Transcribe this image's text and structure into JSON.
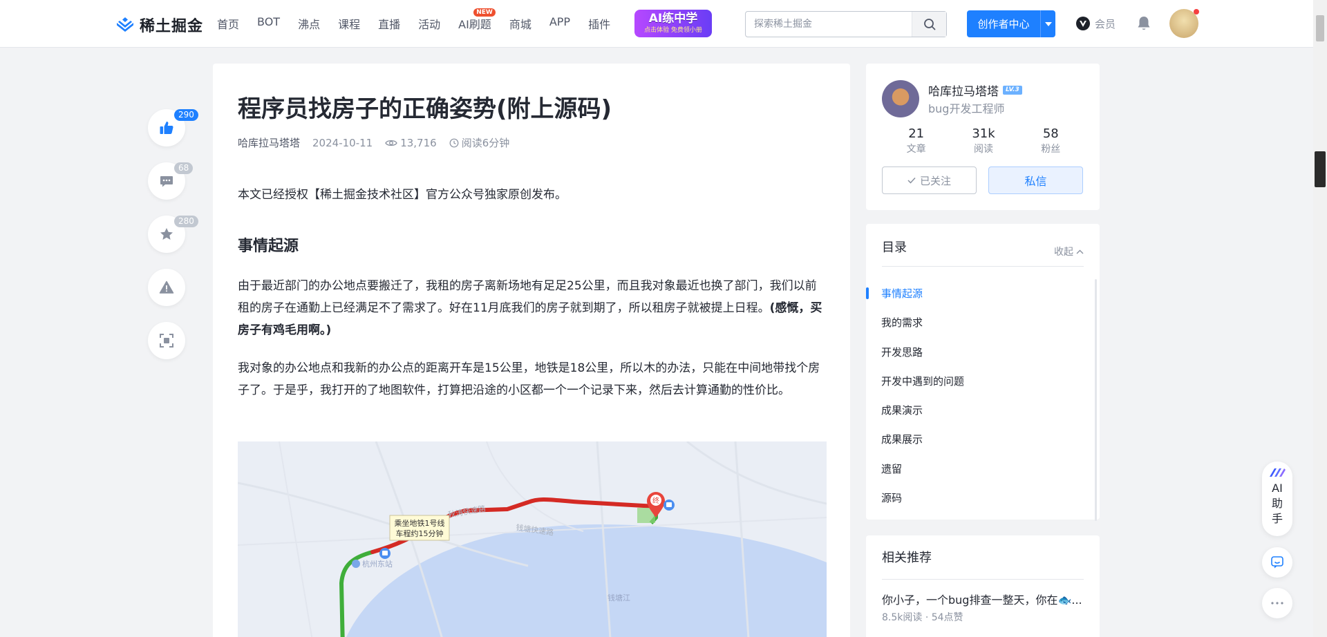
{
  "header": {
    "logo_text": "稀土掘金",
    "nav": [
      "首页",
      "BOT",
      "沸点",
      "课程",
      "直播",
      "活动",
      "AI刷题",
      "商城",
      "APP",
      "插件"
    ],
    "nav_badge": "NEW",
    "ai_banner_title": "AI练中学",
    "ai_banner_sub": "点击体验 免费领小册",
    "search_placeholder": "探索稀土掘金",
    "creator_label": "创作者中心",
    "vip_label": "会员"
  },
  "actions": {
    "like_count": "290",
    "comment_count": "68",
    "collect_count": "280"
  },
  "article": {
    "title": "程序员找房子的正确姿势(附上源码)",
    "author": "哈库拉马塔塔",
    "date": "2024-10-11",
    "views": "13,716",
    "read_time": "阅读6分钟",
    "intro": "本文已经授权【稀土掘金技术社区】官方公众号独家原创发布。",
    "section1_title": "事情起源",
    "para1": "由于最近部门的办公地点要搬迁了，我租的房子离新场地有足足25公里，而且我对象最近也换了部门，我们以前租的房子在通勤上已经满足不了需求了。好在11月底我们的房子就到期了，所以租房子就被提上日程。",
    "para1_bold": "(感慨，买房子有鸡毛用啊。)",
    "para2": "我对象的办公地点和我新的办公点的距离开车是15公里，地铁是18公里，所以木的办法，只能在中间地带找个房子了。于是乎，我打开的了地图软件，打算把沿途的小区都一个一个记录下来，然后去计算通勤的性价比。",
    "map": {
      "route_label_line1": "乘坐地铁1号线",
      "route_label_line2": "车程约15分钟",
      "road1": "秋涛快速路",
      "road2": "钱塘快速路",
      "station": "杭州东站",
      "river": "钱塘江",
      "end_marker": "终"
    }
  },
  "author_card": {
    "name": "哈库拉马塔塔",
    "level": "LV.3",
    "job": "bug开发工程师",
    "stats": [
      {
        "num": "21",
        "label": "文章"
      },
      {
        "num": "31k",
        "label": "阅读"
      },
      {
        "num": "58",
        "label": "粉丝"
      }
    ],
    "follow_label": "已关注",
    "message_label": "私信"
  },
  "toc": {
    "title": "目录",
    "collapse_label": "收起",
    "items": [
      "事情起源",
      "我的需求",
      "开发思路",
      "开发中遇到的问题",
      "成果演示",
      "成果展示",
      "遗留",
      "源码"
    ]
  },
  "recommend": {
    "title": "相关推荐",
    "item_title": "你小子，一个bug排查一整天，你在🐟...",
    "item_meta": "8.5k阅读 · 54点赞"
  },
  "ai_helper": {
    "label": "AI助手"
  },
  "colors": {
    "brand": "#1e80ff",
    "route_red": "#d42a24",
    "route_green": "#3fae3a"
  }
}
